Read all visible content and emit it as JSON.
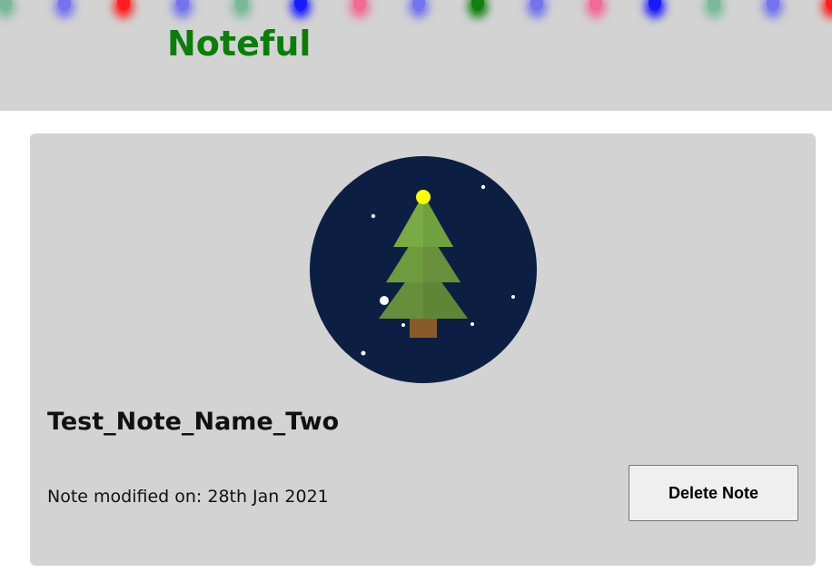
{
  "app": {
    "title": "Noteful",
    "title_color": "#0a7d0a",
    "lights": [
      "#7bb89a",
      "#7474ec",
      "#ff1f1f",
      "#7474ec",
      "#7bb89a",
      "#1a1aff",
      "#f06b96",
      "#7474ec",
      "#128012",
      "#7474ec",
      "#f06b96",
      "#1a1aff",
      "#7bb89a",
      "#7474ec",
      "#ff1f1f"
    ]
  },
  "note": {
    "name": "Test_Note_Name_Two",
    "modified_text": "Note modified on: 28th Jan 2021",
    "illustration": "christmas-tree-icon",
    "delete_label": "Delete Note"
  }
}
